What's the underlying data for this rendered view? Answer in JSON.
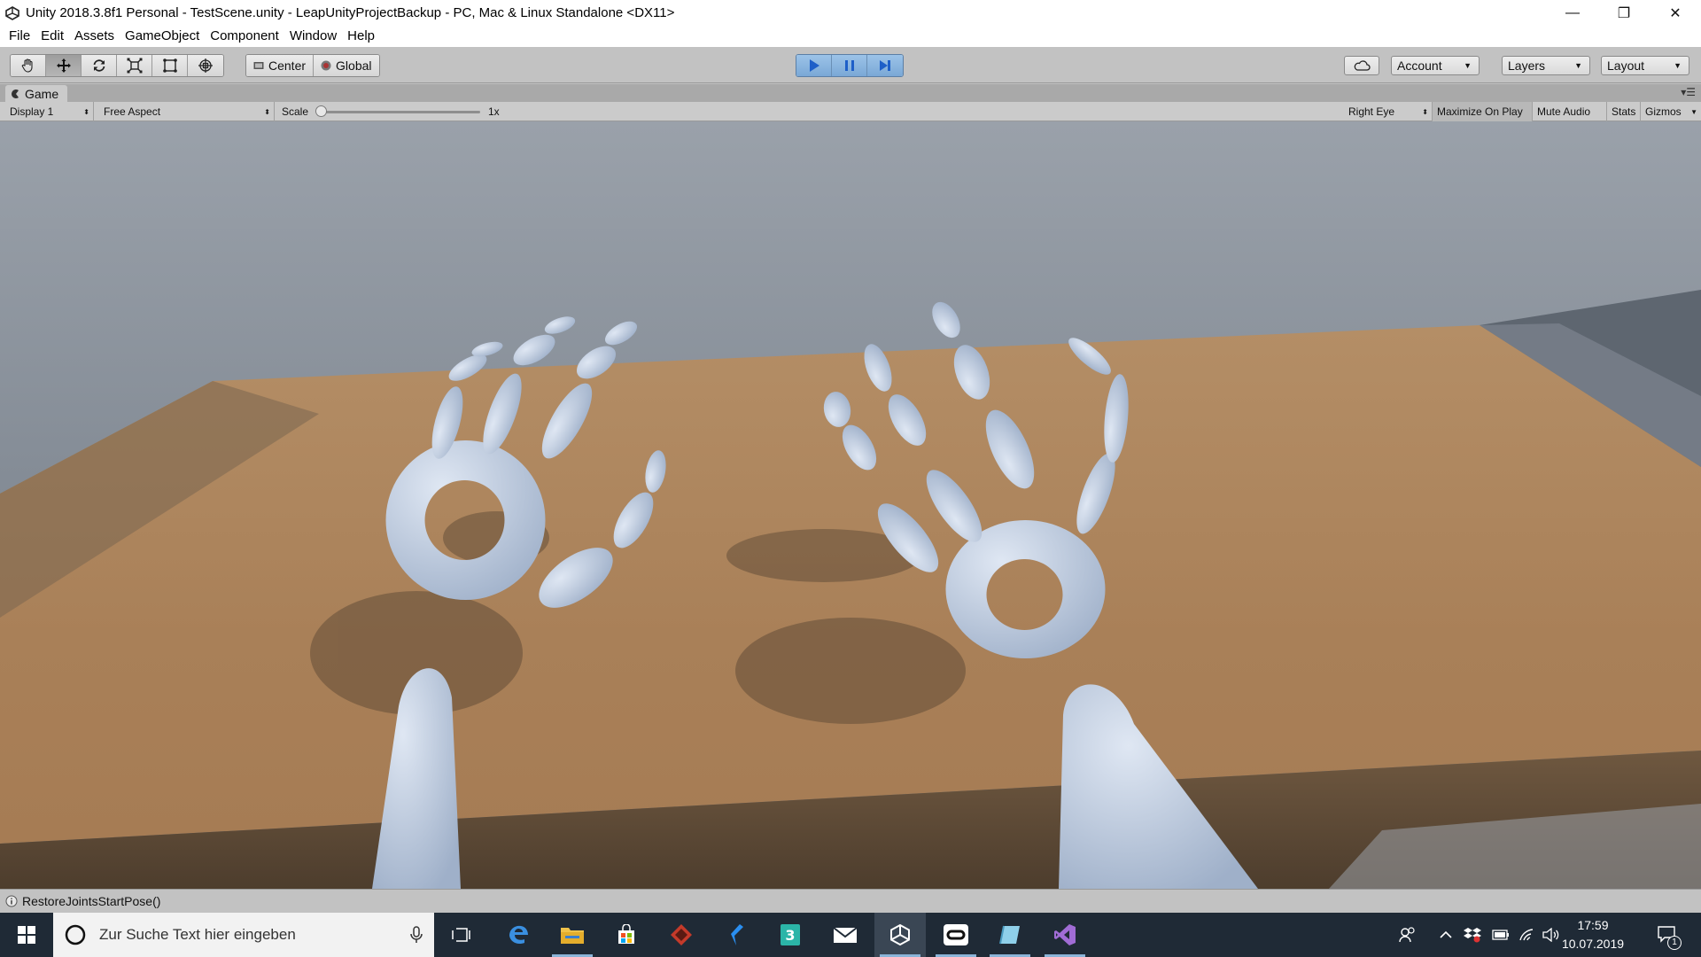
{
  "window": {
    "title": "Unity 2018.3.8f1 Personal - TestScene.unity - LeapUnityProjectBackup - PC, Mac & Linux Standalone <DX11>",
    "minimize_glyph": "—",
    "restore_glyph": "❐",
    "close_glyph": "✕"
  },
  "menu": {
    "items": [
      "File",
      "Edit",
      "Assets",
      "GameObject",
      "Component",
      "Window",
      "Help"
    ]
  },
  "toolbar": {
    "tools": [
      "hand-tool-icon",
      "move-tool-icon",
      "rotate-tool-icon",
      "scale-tool-icon",
      "rect-tool-icon",
      "transform-tool-icon"
    ],
    "pivot_mode": "Center",
    "pivot_rotation": "Global",
    "account_label": "Account",
    "layers_label": "Layers",
    "layout_label": "Layout",
    "play_color": "#2f6fd6"
  },
  "game_panel": {
    "tab_label": "Game",
    "display": "Display 1",
    "aspect": "Free Aspect",
    "scale_label": "Scale",
    "scale_value": "1x",
    "eye": "Right Eye",
    "maximize": "Maximize On Play",
    "mute": "Mute Audio",
    "stats": "Stats",
    "gizmos": "Gizmos"
  },
  "status": {
    "message": "RestoreJointsStartPose()"
  },
  "taskbar": {
    "search_placeholder": "Zur Suche Text hier eingeben",
    "time": "17:59",
    "date": "10.07.2019",
    "notification_count": "1",
    "apps": [
      "task-view-icon",
      "edge-icon",
      "file-explorer-icon",
      "store-icon",
      "game-app-icon",
      "visual-studio-code-icon",
      "app-3-icon",
      "mail-icon",
      "unity-icon",
      "oculus-icon",
      "app-blue-icon",
      "visual-studio-icon"
    ]
  },
  "colors": {
    "table_wood": "#b08860",
    "hand_color": "#b7c6dd",
    "wall": "#727b86"
  }
}
